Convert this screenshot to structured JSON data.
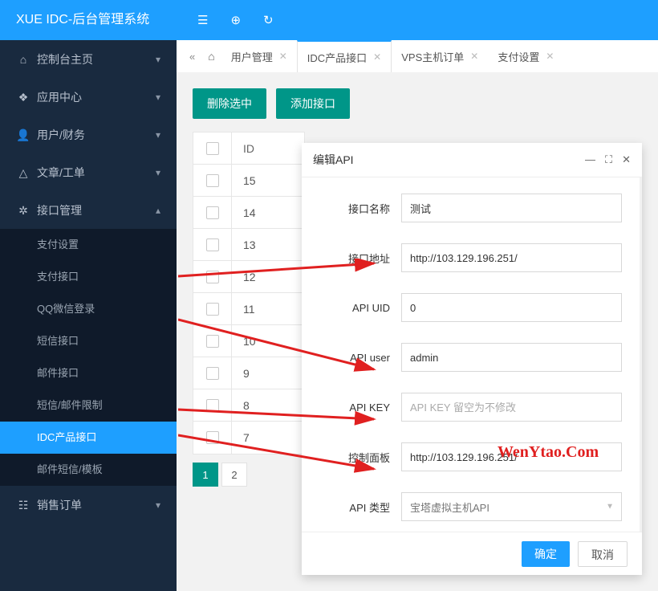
{
  "brand": "XUE IDC-后台管理系统",
  "top_icons": [
    "menu-toggle",
    "globe",
    "refresh"
  ],
  "sidebar": {
    "items": [
      {
        "label": "控制台主页",
        "icon": "home"
      },
      {
        "label": "应用中心",
        "icon": "apps"
      },
      {
        "label": "用户/财务",
        "icon": "user"
      },
      {
        "label": "文章/工单",
        "icon": "bell"
      },
      {
        "label": "接口管理",
        "icon": "gear",
        "expanded": true,
        "children": [
          {
            "label": "支付设置"
          },
          {
            "label": "支付接口"
          },
          {
            "label": "QQ微信登录"
          },
          {
            "label": "短信接口"
          },
          {
            "label": "邮件接口"
          },
          {
            "label": "短信/邮件限制"
          },
          {
            "label": "IDC产品接口",
            "active": true
          },
          {
            "label": "邮件短信/模板"
          }
        ]
      },
      {
        "label": "销售订单",
        "icon": "list"
      }
    ]
  },
  "tabs": [
    {
      "label": "用户管理",
      "closable": true
    },
    {
      "label": "IDC产品接口",
      "closable": true,
      "active": true
    },
    {
      "label": "VPS主机订单",
      "closable": true
    },
    {
      "label": "支付设置",
      "closable": true
    }
  ],
  "buttons": {
    "del": "删除选中",
    "add": "添加接口"
  },
  "table": {
    "header": "ID",
    "rows": [
      "15",
      "14",
      "13",
      "12",
      "11",
      "10",
      "9",
      "8",
      "7"
    ]
  },
  "pager": {
    "pages": [
      "1",
      "2"
    ],
    "active": 0
  },
  "modal": {
    "title": "编辑API",
    "ok": "确定",
    "cancel": "取消",
    "fields": {
      "name_label": "接口名称",
      "name_value": "测试",
      "url_label": "接口地址",
      "url_value": "http://103.129.196.251/",
      "uid_label": "API UID",
      "uid_value": "0",
      "user_label": "API user",
      "user_value": "admin",
      "key_label": "API KEY",
      "key_placeholder": "API KEY 留空为不修改",
      "panel_label": "控制面板",
      "panel_value": "http://103.129.196.251/",
      "type_label": "API 类型",
      "type_value": "宝塔虚拟主机API"
    }
  },
  "watermark": "WenYtao.Com"
}
